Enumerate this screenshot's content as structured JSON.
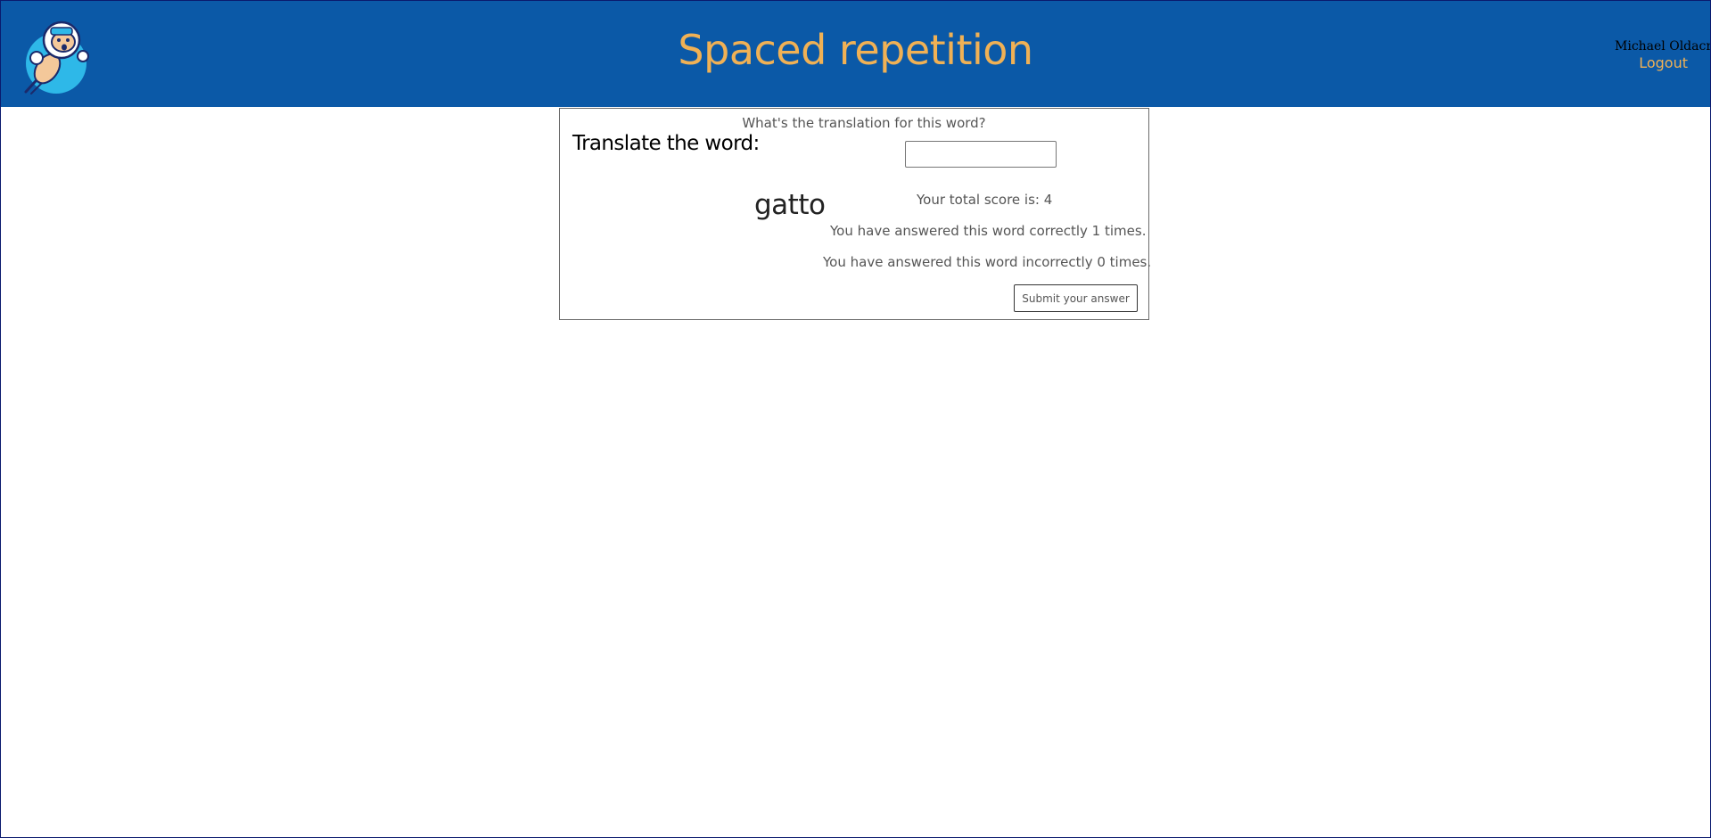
{
  "header": {
    "title": "Spaced repetition",
    "user_name": "Michael Oldacre",
    "logout_label": "Logout",
    "logo_icon": "astronaut-riding-rocket-logo",
    "background_color": "#0b59a7",
    "title_color": "#f0b155"
  },
  "learn": {
    "heading": "Translate the word:",
    "word": "gatto",
    "question": "What's the translation for this word?",
    "input_value": "",
    "input_placeholder": "",
    "score_text": "Your total score is: 4",
    "correct_text": "You have answered this word correctly 1 times.",
    "incorrect_text": "You have answered this word incorrectly 0 times.",
    "submit_label": "Submit your answer"
  }
}
